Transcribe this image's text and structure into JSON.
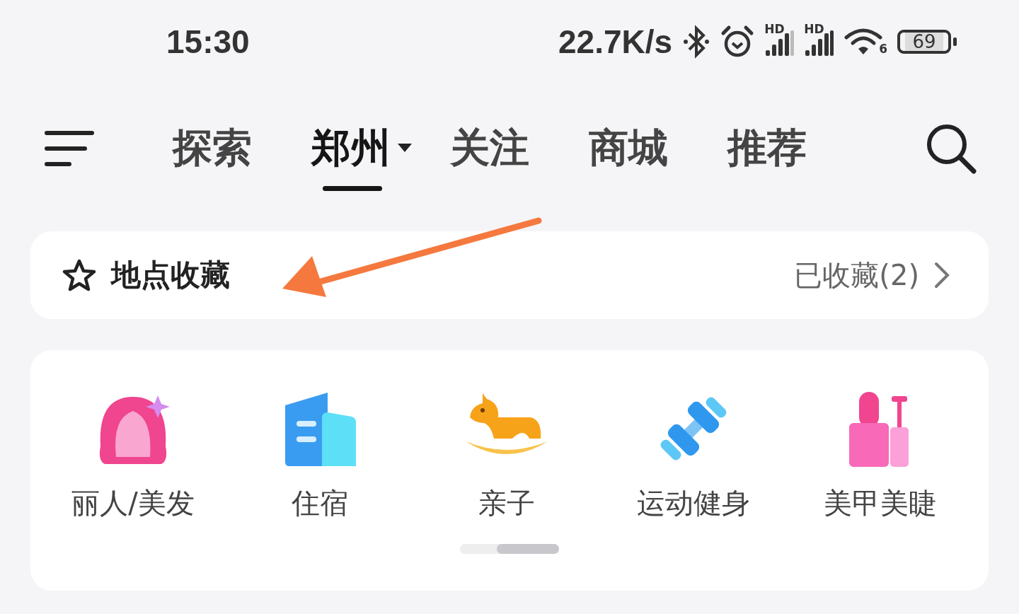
{
  "status_bar": {
    "time": "15:30",
    "net_speed": "22.7K/s",
    "signal_labels": [
      "HD",
      "HD"
    ],
    "wifi_label": "6",
    "battery": "69"
  },
  "tabs": [
    {
      "label": "探索",
      "selected": false,
      "kind": "plain"
    },
    {
      "label": "郑州",
      "selected": true,
      "kind": "dropdown"
    },
    {
      "label": "关注",
      "selected": false,
      "kind": "plain"
    },
    {
      "label": "商城",
      "selected": false,
      "kind": "plain"
    },
    {
      "label": "推荐",
      "selected": false,
      "kind": "plain"
    }
  ],
  "favorites": {
    "title": "地点收藏",
    "count_label": "已收藏(2)"
  },
  "categories": [
    {
      "label": "丽人/美发",
      "kind": "beauty"
    },
    {
      "label": "住宿",
      "kind": "hotel"
    },
    {
      "label": "亲子",
      "kind": "kids"
    },
    {
      "label": "运动健身",
      "kind": "fitness"
    },
    {
      "label": "美甲美睫",
      "kind": "nails"
    }
  ]
}
